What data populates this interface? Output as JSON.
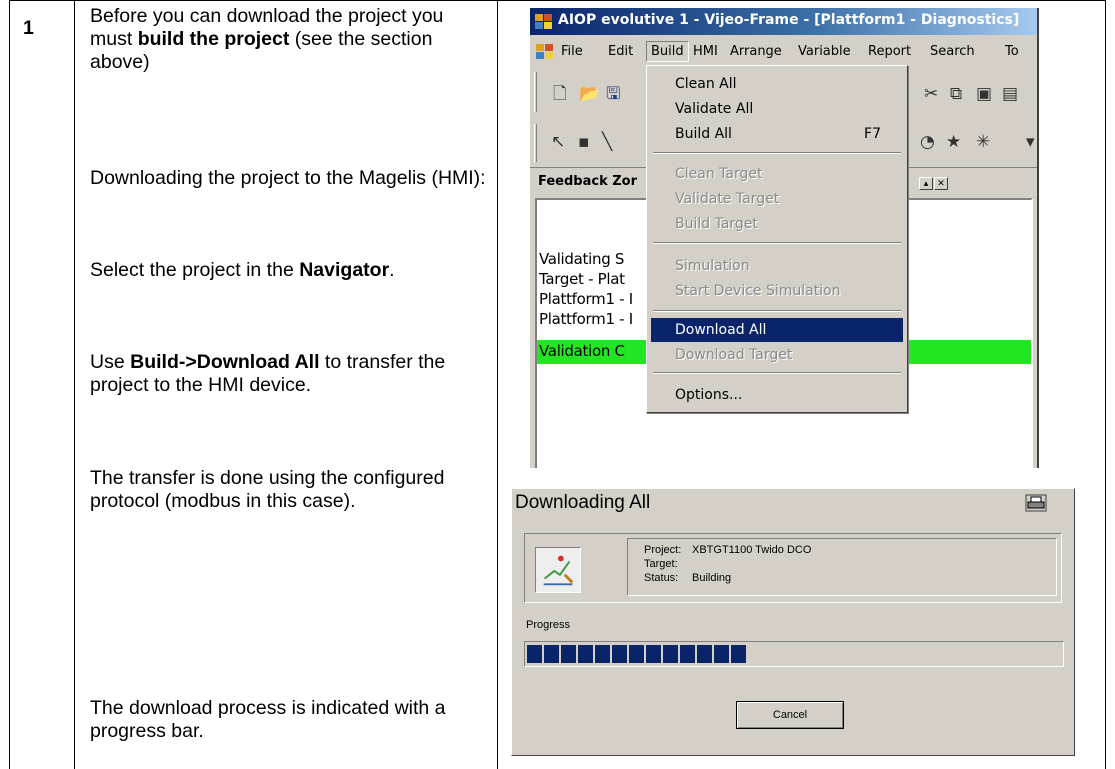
{
  "step_number": "1",
  "instructions": {
    "p1_pre": "Before you can download the project you must ",
    "p1_bold": "build the project",
    "p1_post": " (see the section above)",
    "p2": "Downloading the project to the Magelis (HMI):",
    "p3_pre": "Select the project in the ",
    "p3_bold": "Navigator",
    "p3_post": ".",
    "p4_pre": "Use ",
    "p4_bold": "Build->Download All",
    "p4_post": " to transfer the project to the HMI device.",
    "p5": "The transfer is done using the configured protocol (modbus in this case).",
    "p6": "The download process is indicated with a progress bar."
  },
  "vijeo_window": {
    "title": "AIOP evolutive 1 - Vijeo-Frame - [Plattform1 - Diagnostics]",
    "menu": [
      "File",
      "Edit",
      "Build",
      "HMI",
      "Arrange",
      "Variable",
      "Report",
      "Search",
      "To"
    ],
    "feedback_title": "Feedback Zor",
    "feedback_lines": [
      "Validating S",
      "Target - Plat",
      "Plattform1 - I",
      "Plattform1 - I",
      "Validation C"
    ],
    "highlight_color": "#22e622"
  },
  "build_menu": {
    "clean_all": "Clean All",
    "validate_all": "Validate All",
    "build_all": "Build All",
    "build_all_shortcut": "F7",
    "clean_target": "Clean Target",
    "validate_target": "Validate Target",
    "build_target": "Build Target",
    "simulation": "Simulation",
    "start_device_simulation": "Start Device Simulation",
    "download_all": "Download All",
    "download_target": "Download Target",
    "options": "Options..."
  },
  "download_dialog": {
    "title": "Downloading All",
    "project_label": "Project:",
    "project_value": "XBTGT1100 Twido DCO",
    "target_label": "Target:",
    "target_value": "",
    "status_label": "Status:",
    "status_value": "Building",
    "progress_label": "Progress",
    "progress_fraction": 0.41,
    "cancel_label": "Cancel"
  }
}
